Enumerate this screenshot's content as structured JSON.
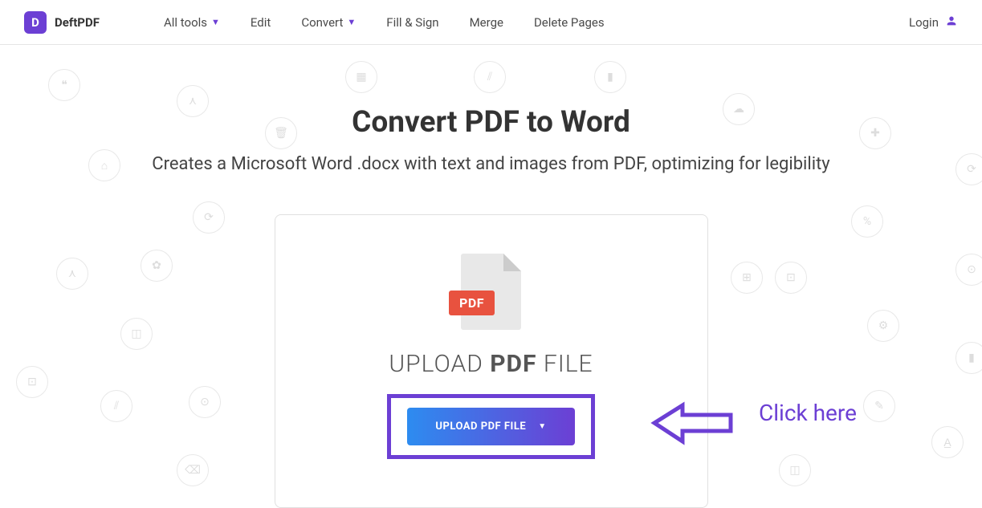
{
  "brand": {
    "logo_letter": "D",
    "name": "DeftPDF"
  },
  "nav": {
    "all_tools": "All tools",
    "edit": "Edit",
    "convert": "Convert",
    "fill_sign": "Fill & Sign",
    "merge": "Merge",
    "delete_pages": "Delete Pages"
  },
  "login": {
    "label": "Login"
  },
  "main": {
    "title": "Convert PDF to Word",
    "subtitle": "Creates a Microsoft Word .docx with text and images from PDF, optimizing for legibility"
  },
  "upload": {
    "pdf_badge": "PDF",
    "heading_1": "UPLOAD ",
    "heading_bold": "PDF",
    "heading_2": " FILE",
    "button_label": "UPLOAD PDF FILE"
  },
  "annotation": {
    "click_here": "Click here"
  }
}
